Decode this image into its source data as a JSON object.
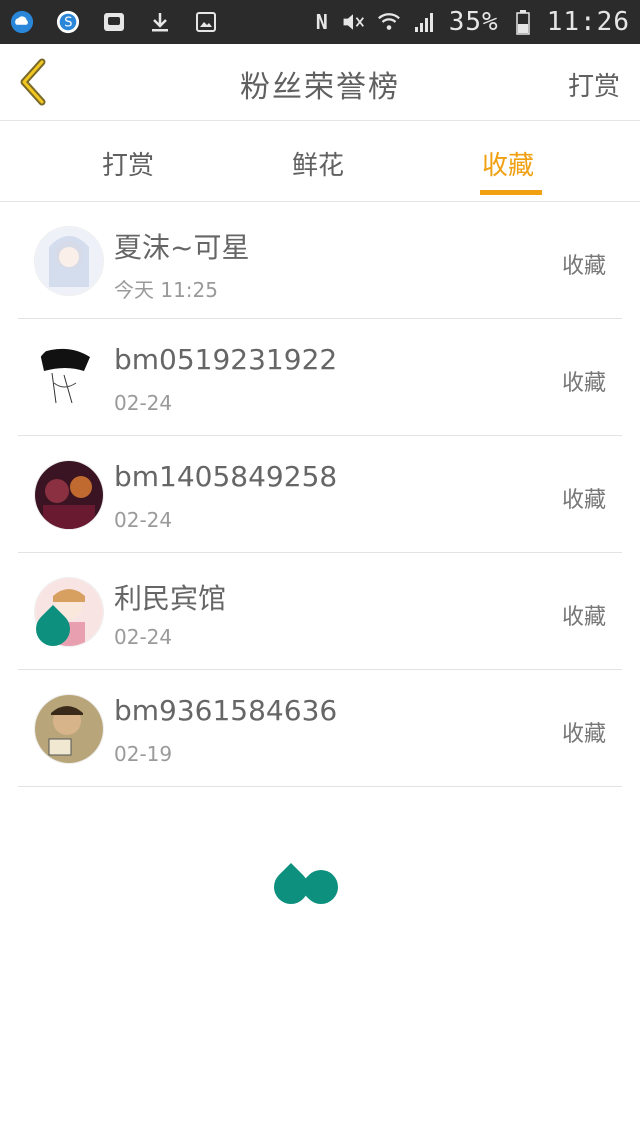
{
  "status_bar": {
    "signal_label": "N",
    "battery": "35%",
    "time": "11:26"
  },
  "header": {
    "title": "粉丝荣誉榜",
    "action": "打赏"
  },
  "tabs": [
    {
      "label": "打赏",
      "active": false
    },
    {
      "label": "鲜花",
      "active": false
    },
    {
      "label": "收藏",
      "active": true
    }
  ],
  "list": [
    {
      "name": "夏沫~可星",
      "date": "今天 11:25",
      "action": "收藏"
    },
    {
      "name": "bm0519231922",
      "date": "02-24",
      "action": "收藏"
    },
    {
      "name": "bm1405849258",
      "date": "02-24",
      "action": "收藏"
    },
    {
      "name": "利民宾馆",
      "date": "02-24",
      "action": "收藏"
    },
    {
      "name": "bm9361584636",
      "date": "02-19",
      "action": "收藏"
    }
  ],
  "colors": {
    "accent": "#f0a010",
    "drop": "#0e907e"
  }
}
